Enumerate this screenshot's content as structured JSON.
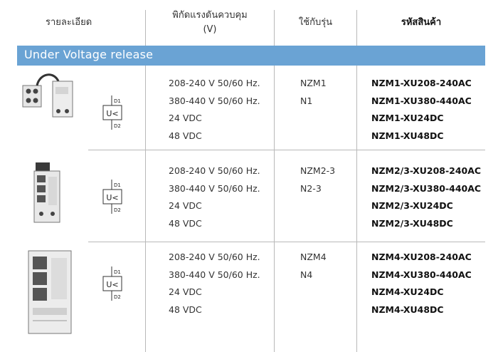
{
  "header": {
    "detail": "รายละเอียด",
    "voltage_line1": "พิกัดแรงดันควบคุม",
    "voltage_line2": "(V)",
    "model": "ใช้กับรุ่น",
    "code": "รหัสสินค้า"
  },
  "section": {
    "title": "Under Voltage release"
  },
  "symbol": {
    "label": "U<",
    "terminal_top": "D1",
    "terminal_bottom": "D2"
  },
  "rows": [
    {
      "voltages": [
        "208-240 V 50/60 Hz.",
        "380-440 V 50/60 Hz.",
        "24 VDC",
        "48 VDC"
      ],
      "models": [
        "NZM1",
        "N1"
      ],
      "codes": [
        "NZM1-XU208-240AC",
        "NZM1-XU380-440AC",
        "NZM1-XU24DC",
        "NZM1-XU48DC"
      ]
    },
    {
      "voltages": [
        "208-240 V 50/60 Hz.",
        "380-440 V 50/60 Hz.",
        "24 VDC",
        "48 VDC"
      ],
      "models": [
        "NZM2-3",
        "N2-3"
      ],
      "codes": [
        "NZM2/3-XU208-240AC",
        "NZM2/3-XU380-440AC",
        "NZM2/3-XU24DC",
        "NZM2/3-XU48DC"
      ]
    },
    {
      "voltages": [
        "208-240 V 50/60 Hz.",
        "380-440 V 50/60 Hz.",
        "24 VDC",
        "48 VDC"
      ],
      "models": [
        "NZM4",
        "N4"
      ],
      "codes": [
        "NZM4-XU208-240AC",
        "NZM4-XU380-440AC",
        "NZM4-XU24DC",
        "NZM4-XU48DC"
      ]
    }
  ],
  "colors": {
    "band": "#6aa3d4",
    "grid": "#b9b9b9",
    "band_text": "#ffffff"
  }
}
